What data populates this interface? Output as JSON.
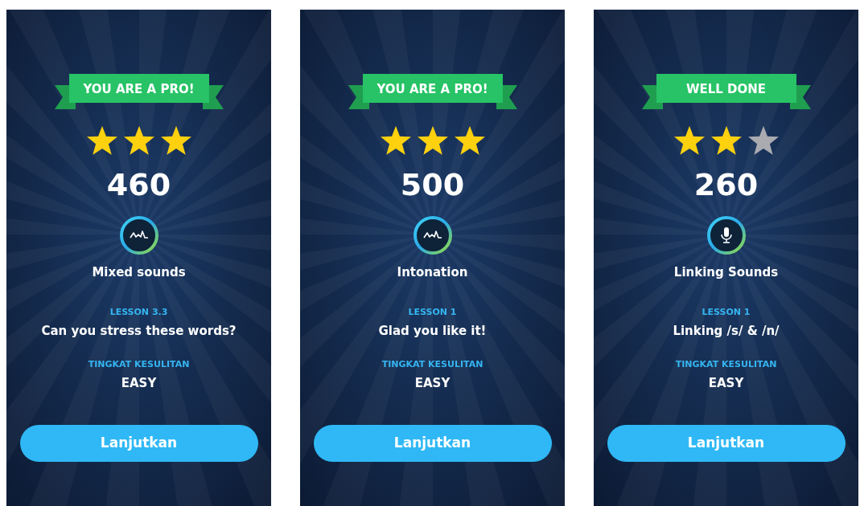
{
  "screens": [
    {
      "banner": "YOU ARE A PRO!",
      "stars": 3,
      "score": "460",
      "kind": "wave",
      "topic": "Mixed sounds",
      "lesson_label": "LESSON 3.3",
      "lesson_title": "Can you stress these words?",
      "difficulty_label": "TINGKAT KESULITAN",
      "difficulty": "EASY",
      "button": "Lanjutkan"
    },
    {
      "banner": "YOU ARE A PRO!",
      "stars": 3,
      "score": "500",
      "kind": "wave",
      "topic": "Intonation",
      "lesson_label": "LESSON 1",
      "lesson_title": "Glad you like it!",
      "difficulty_label": "TINGKAT KESULITAN",
      "difficulty": "EASY",
      "button": "Lanjutkan"
    },
    {
      "banner": "WELL DONE",
      "stars": 2,
      "score": "260",
      "kind": "mic",
      "topic": "Linking Sounds",
      "lesson_label": "LESSON 1",
      "lesson_title": "Linking /s/ & /n/",
      "difficulty_label": "TINGKAT KESULITAN",
      "difficulty": "EASY",
      "button": "Lanjutkan"
    }
  ]
}
